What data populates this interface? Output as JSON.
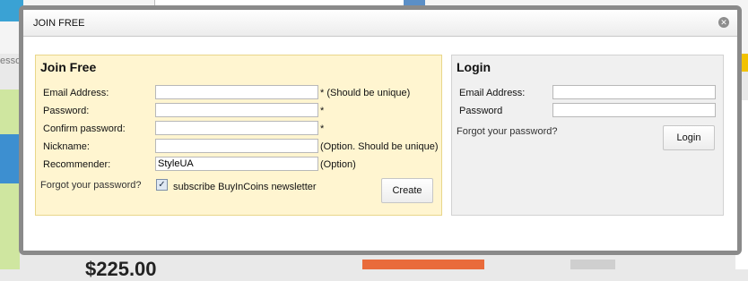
{
  "background": {
    "left_snippet": "essori",
    "price": "$225.00"
  },
  "modal": {
    "title": "JOIN FREE",
    "close_icon": "close-icon"
  },
  "join": {
    "heading": "Join Free",
    "fields": [
      {
        "label": "Email Address:",
        "value": "",
        "note": "* (Should be unique)"
      },
      {
        "label": "Password:",
        "value": "",
        "note": "*"
      },
      {
        "label": "Confirm password:",
        "value": "",
        "note": "*"
      },
      {
        "label": "Nickname:",
        "value": "",
        "note": "(Option. Should be unique)"
      },
      {
        "label": "Recommender:",
        "value": "StyleUA",
        "note": "(Option)"
      }
    ],
    "forgot_link": "Forgot your password?",
    "newsletter_checked": true,
    "newsletter_label": "subscribe BuyInCoins newsletter",
    "create_button": "Create"
  },
  "login": {
    "heading": "Login",
    "fields": [
      {
        "label": "Email Address:",
        "value": ""
      },
      {
        "label": "Password",
        "value": ""
      }
    ],
    "forgot_link": "Forgot your password?",
    "login_button": "Login"
  },
  "colors": {
    "join_panel_bg": "#fff5d0",
    "login_panel_bg": "#f0f0f0",
    "frame": "#8a8a8a"
  }
}
